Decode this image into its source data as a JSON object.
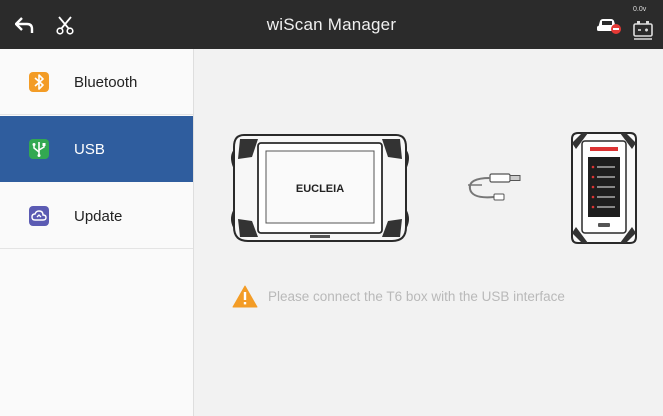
{
  "header": {
    "title": "wiScan Manager",
    "back_icon": "back-arrow-icon",
    "tools_icon": "scissors-icon",
    "car_status_icon": "car-disconnected-icon",
    "voltage_text": "0.0v",
    "battery_icon": "battery-icon"
  },
  "sidebar": {
    "items": [
      {
        "label": "Bluetooth",
        "icon": "bluetooth-icon",
        "icon_color": "#f39c26",
        "active": false
      },
      {
        "label": "USB",
        "icon": "usb-icon",
        "icon_color": "#32a852",
        "active": true
      },
      {
        "label": "Update",
        "icon": "cloud-update-icon",
        "icon_color": "#5b5bb3",
        "active": false
      }
    ]
  },
  "main": {
    "tablet_brand": "EUCLEIA",
    "message": "Please connect the T6 box with the USB interface",
    "warning_icon": "warning-icon",
    "colors": {
      "warning": "#f39c26",
      "active_item": "#2f5d9e",
      "header_bg": "#2b2b2b"
    }
  }
}
